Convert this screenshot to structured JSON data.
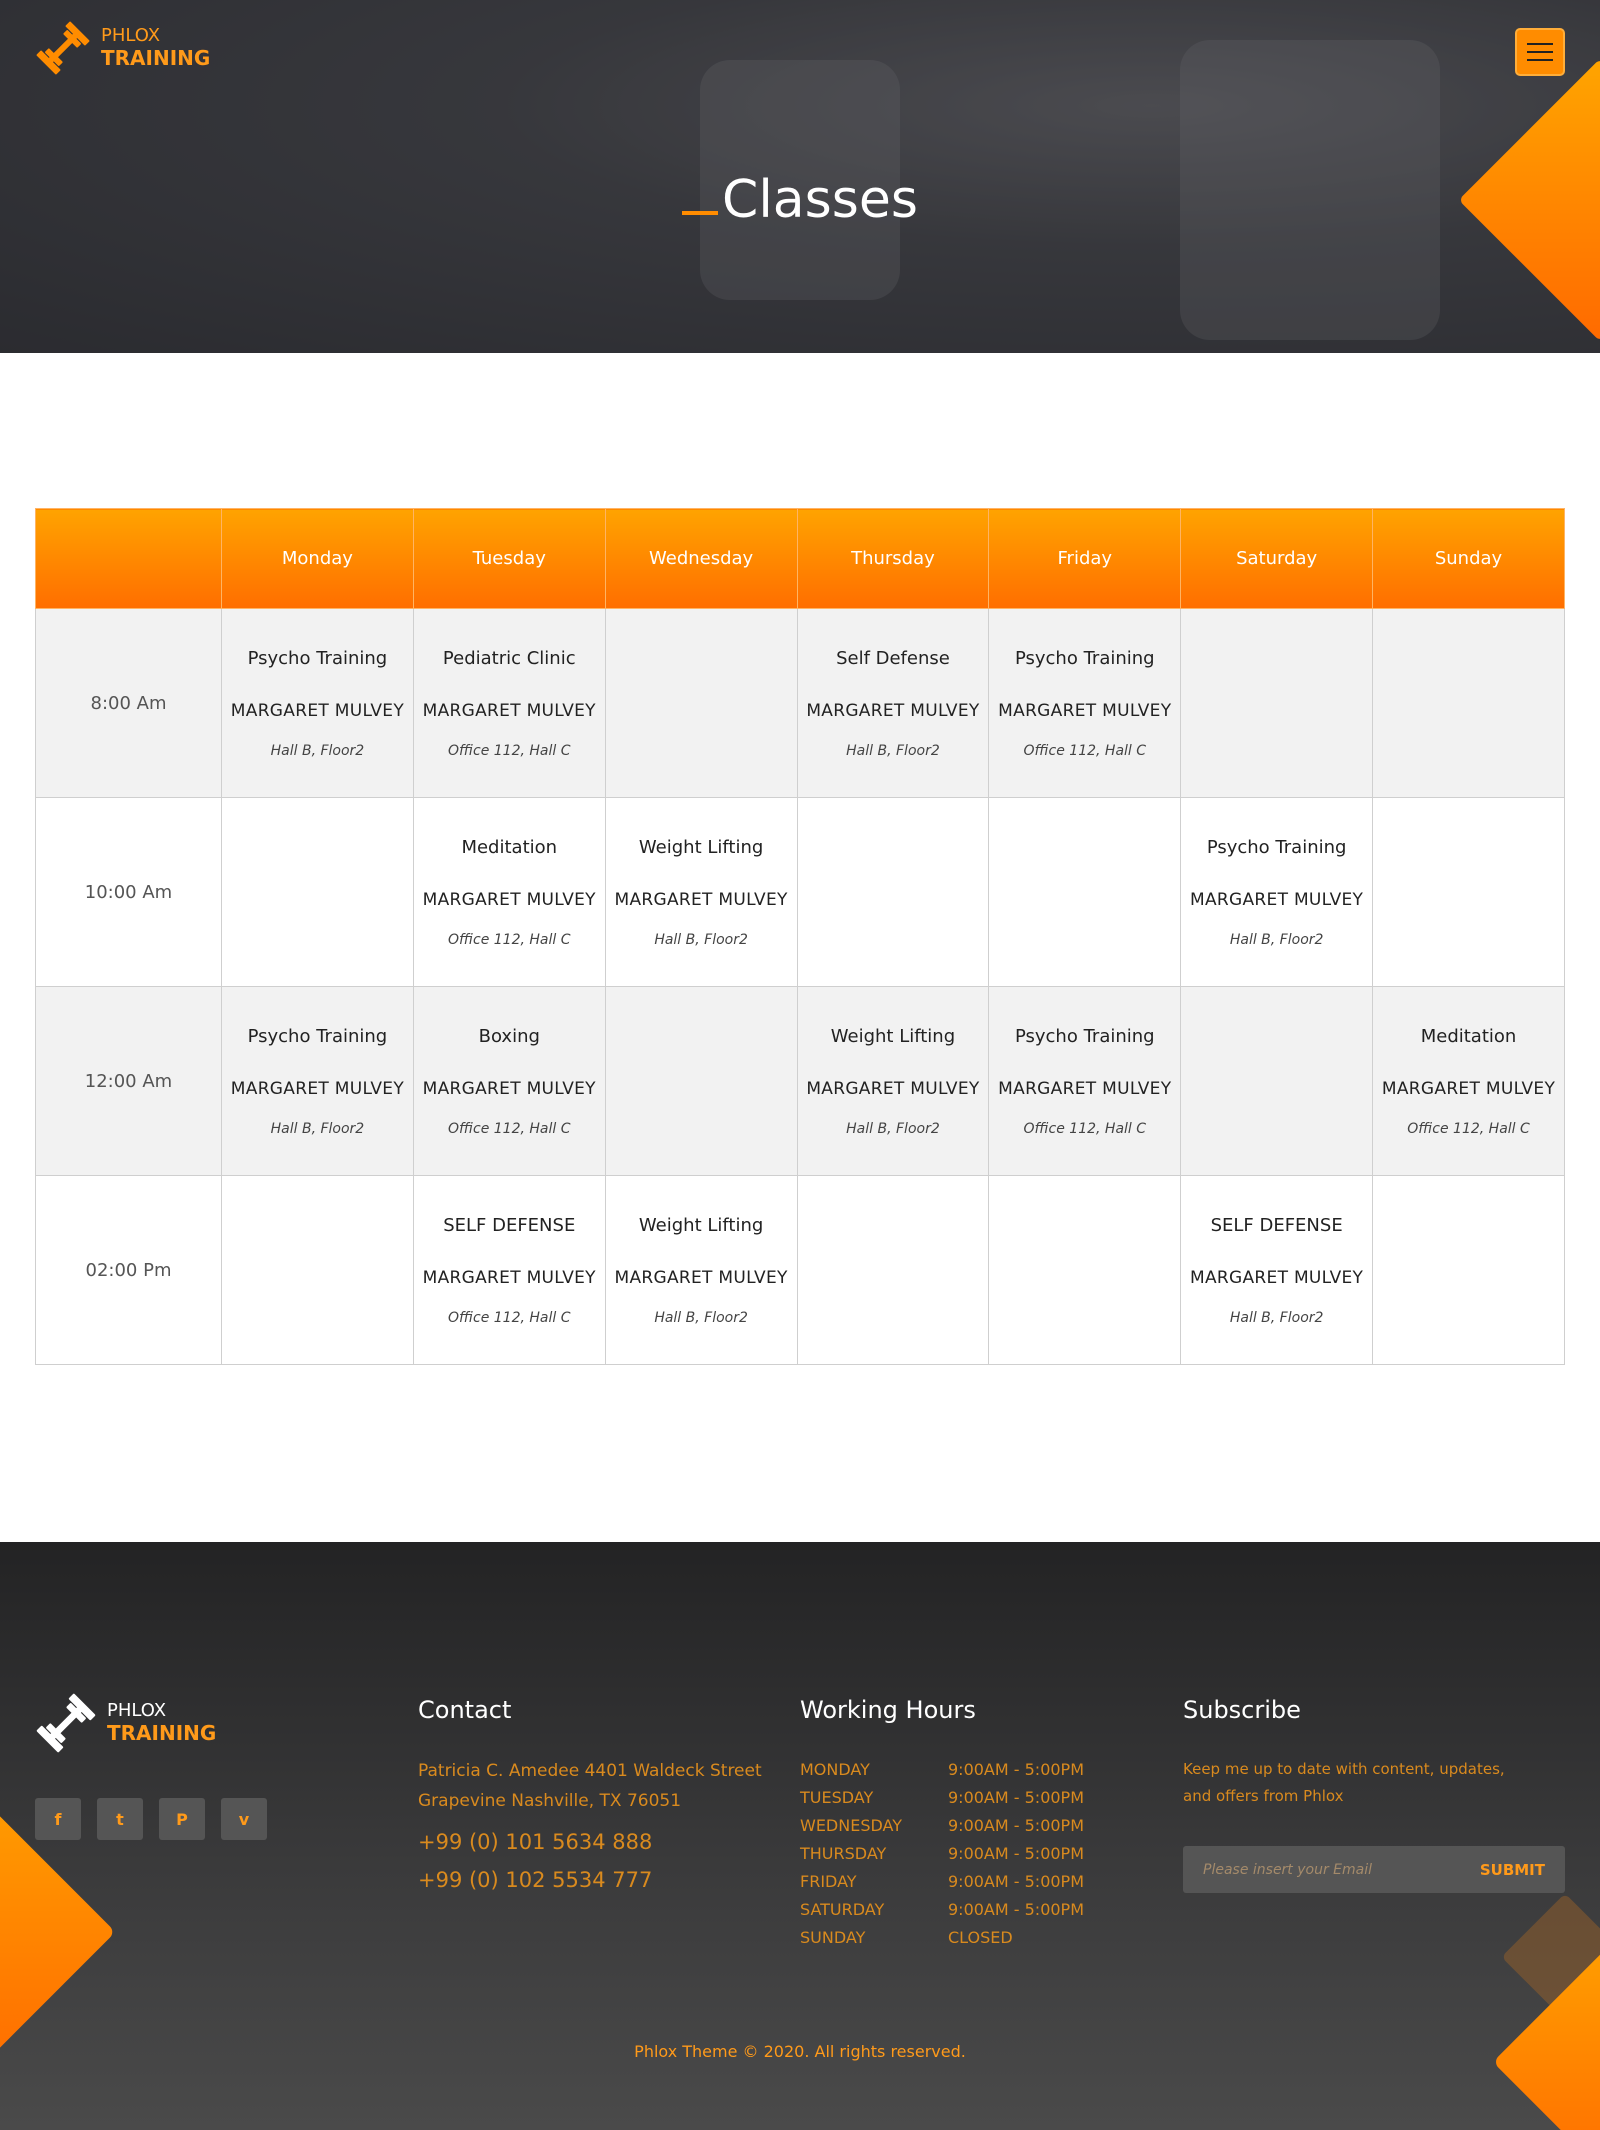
{
  "header": {
    "logo_line1": "PHLOX",
    "logo_line2": "TRAINING",
    "title": "Classes"
  },
  "schedule": {
    "days": [
      "Monday",
      "Tuesday",
      "Wednesday",
      "Thursday",
      "Friday",
      "Saturday",
      "Sunday"
    ],
    "rows": [
      {
        "time": "8:00 Am",
        "cells": [
          {
            "title": "Psycho Training",
            "trainer": "MARGARET MULVEY",
            "room": "Hall B, Floor2"
          },
          {
            "title": "Pediatric Clinic",
            "trainer": "MARGARET MULVEY",
            "room": "Office 112, Hall C"
          },
          null,
          {
            "title": "Self Defense",
            "trainer": "MARGARET MULVEY",
            "room": "Hall B, Floor2"
          },
          {
            "title": "Psycho Training",
            "trainer": "MARGARET MULVEY",
            "room": "Office 112, Hall C"
          },
          null,
          null
        ]
      },
      {
        "time": "10:00 Am",
        "cells": [
          null,
          {
            "title": "Meditation",
            "trainer": "MARGARET MULVEY",
            "room": "Office 112, Hall C"
          },
          {
            "title": "Weight Lifting",
            "trainer": "MARGARET MULVEY",
            "room": "Hall B, Floor2"
          },
          null,
          null,
          {
            "title": "Psycho Training",
            "trainer": "MARGARET MULVEY",
            "room": "Hall B, Floor2"
          },
          null
        ]
      },
      {
        "time": "12:00 Am",
        "cells": [
          {
            "title": "Psycho Training",
            "trainer": "MARGARET MULVEY",
            "room": "Hall B, Floor2"
          },
          {
            "title": "Boxing",
            "trainer": "MARGARET MULVEY",
            "room": "Office 112, Hall C"
          },
          null,
          {
            "title": "Weight Lifting",
            "trainer": "MARGARET MULVEY",
            "room": "Hall B, Floor2"
          },
          {
            "title": "Psycho Training",
            "trainer": "MARGARET MULVEY",
            "room": "Office 112, Hall C"
          },
          null,
          {
            "title": "Meditation",
            "trainer": "MARGARET MULVEY",
            "room": "Office 112, Hall C"
          }
        ]
      },
      {
        "time": "02:00 Pm",
        "cells": [
          null,
          {
            "title": "SELF DEFENSE",
            "trainer": "MARGARET MULVEY",
            "room": "Office 112, Hall C"
          },
          {
            "title": "Weight Lifting",
            "trainer": "MARGARET MULVEY",
            "room": "Hall B, Floor2"
          },
          null,
          null,
          {
            "title": "SELF DEFENSE",
            "trainer": "MARGARET MULVEY",
            "room": "Hall B, Floor2"
          },
          null
        ]
      }
    ]
  },
  "footer": {
    "logo_line1": "PHLOX",
    "logo_line2": "TRAINING",
    "social": [
      {
        "icon": "facebook-icon",
        "glyph": "f"
      },
      {
        "icon": "twitter-icon",
        "glyph": "t"
      },
      {
        "icon": "pinterest-icon",
        "glyph": "P"
      },
      {
        "icon": "vimeo-icon",
        "glyph": "v"
      }
    ],
    "contact": {
      "heading": "Contact",
      "address_line1": "Patricia C. Amedee 4401 Waldeck Street",
      "address_line2": "Grapevine Nashville, TX 76051",
      "phone1": "+99 (0) 101 5634 888",
      "phone2": "+99 (0) 102 5534 777"
    },
    "hours": {
      "heading": "Working Hours",
      "rows": [
        {
          "day": "MONDAY",
          "time": "9:00AM - 5:00PM"
        },
        {
          "day": "TUESDAY",
          "time": "9:00AM - 5:00PM"
        },
        {
          "day": "WEDNESDAY",
          "time": "9:00AM - 5:00PM"
        },
        {
          "day": "THURSDAY",
          "time": "9:00AM - 5:00PM"
        },
        {
          "day": "FRIDAY",
          "time": "9:00AM - 5:00PM"
        },
        {
          "day": "SATURDAY",
          "time": "9:00AM - 5:00PM"
        },
        {
          "day": "SUNDAY",
          "time": "CLOSED"
        }
      ]
    },
    "subscribe": {
      "heading": "Subscribe",
      "text_line1": "Keep me up to date with content, updates,",
      "text_line2": "and offers from Phlox",
      "placeholder": "Please insert your Email",
      "button": "SUBMIT"
    },
    "copyright": "Phlox Theme © 2020. All rights reserved."
  },
  "colors": {
    "accent": "#ff8c00",
    "accent_light": "#ffa300",
    "footer_text": "#d98a1e"
  }
}
